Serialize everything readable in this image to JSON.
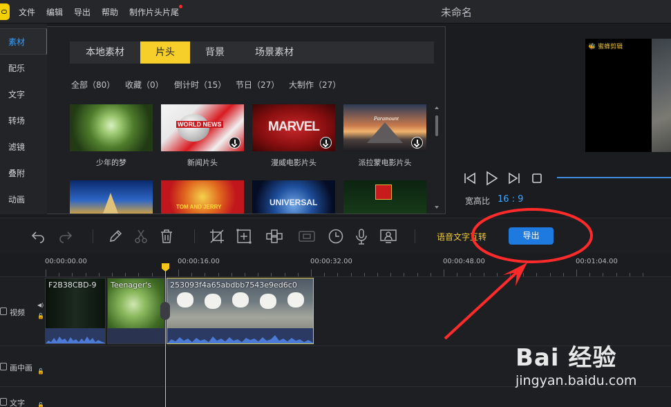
{
  "app": {
    "title": "未命名"
  },
  "menu": [
    "文件",
    "编辑",
    "导出",
    "帮助",
    "制作片头片尾"
  ],
  "sidebar": {
    "items": [
      "素材",
      "配乐",
      "文字",
      "转场",
      "滤镜",
      "叠附",
      "动画"
    ],
    "active_index": 0
  },
  "library": {
    "tabs": [
      "本地素材",
      "片头",
      "背景",
      "场景素材"
    ],
    "active_tab": 1,
    "filters": [
      "全部（80）",
      "收藏（0）",
      "倒计时（15）",
      "节日（27）",
      "大制作（27）"
    ],
    "items": [
      {
        "label": "少年的梦",
        "icon": ""
      },
      {
        "label": "新闻片头",
        "icon": "download-icon",
        "art": "WORLD NEWS"
      },
      {
        "label": "漫威电影片头",
        "icon": "download-icon",
        "art": "MARVEL"
      },
      {
        "label": "派拉蒙电影片头",
        "icon": "download-icon",
        "art": "Paramount"
      }
    ],
    "row2": [
      {
        "art": ""
      },
      {
        "art": "TOM AND JERRY"
      },
      {
        "art": "UNIVERSAL"
      },
      {
        "art": ""
      }
    ]
  },
  "preview": {
    "watermark": "🐝 蜜蜂剪辑",
    "aspect_label": "宽高比",
    "aspect_value": "16 : 9"
  },
  "toolbar": {
    "speech_label": "语音文字互转",
    "export_label": "导出"
  },
  "timeline": {
    "ruler": [
      "00:00:00.00",
      "00:00:16.00",
      "00:00:32.00",
      "00:00:48.00",
      "00:01:04.00"
    ],
    "tracks": [
      "视频",
      "画中画",
      "文字"
    ],
    "clips": [
      {
        "name": "F2B38CBD-9"
      },
      {
        "name": "Teenager's"
      },
      {
        "name": "253093f4a65abdbb7543e9ed6c0"
      }
    ]
  },
  "watermark": {
    "logo": "Bai 经验",
    "url": "jingyan.baidu.com"
  },
  "colors": {
    "accent": "#f7cf2a",
    "export": "#1f7adf",
    "annotation": "#ff2b2b",
    "link": "#3ea6ff"
  }
}
